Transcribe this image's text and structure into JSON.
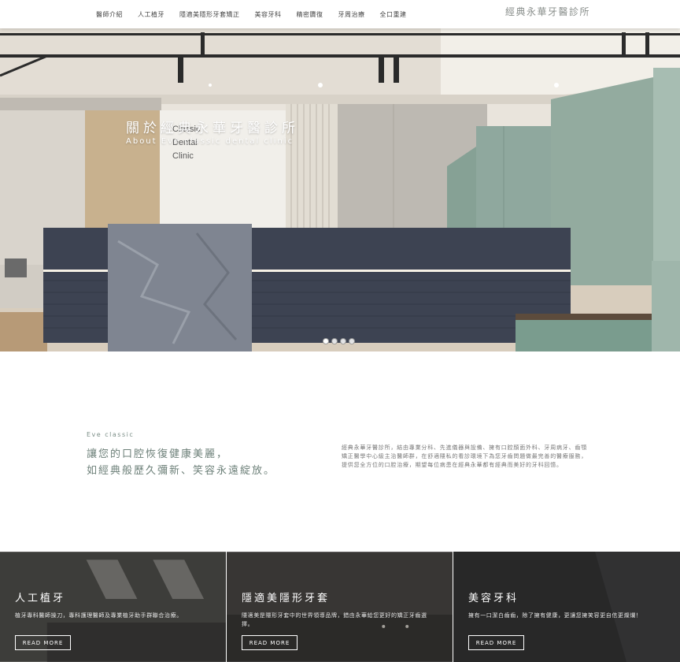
{
  "header": {
    "nav": [
      "醫師介紹",
      "人工植牙",
      "隱適美隱形牙套矯正",
      "美容牙科",
      "精密贗復",
      "牙周治療",
      "全口重建"
    ],
    "logo": "經典永華牙醫診所"
  },
  "hero": {
    "title": "關於經典永華牙醫診所",
    "subtitle": "About Eve classic dental clinic",
    "wall_sign": "Classic\nDental\nClinic",
    "slides": 4,
    "active_slide": 1
  },
  "about": {
    "eyebrow": "Eve classic",
    "headline_line1": "讓您的口腔恢復健康美麗，",
    "headline_line2": "如經典般歷久彌新、笑容永遠綻放。",
    "intro": "經典永華牙醫診所，結由專業分科、先進儀器與設備、擁有口腔顏面外科、牙周病牙、齒顎矯正醫學中心級主治醫師群，在舒適隱私的看診環境下為您牙齒問題做最完善的醫療服務，提供您全方位的口腔治療，期望每位病患在經典永華都有經典而美好的牙科回憶。"
  },
  "cards": [
    {
      "title": "人工植牙",
      "desc": "植牙專科醫師操刀，專科護理醫師及專業植牙助手群聯合治療。",
      "button": "READ MORE"
    },
    {
      "title": "隱適美隱形牙套",
      "desc": "隱適美是隱形牙套中的世界領導品牌，錯由永華給您更好的矯正牙齒選擇。",
      "button": "READ MORE"
    },
    {
      "title": "美容牙科",
      "desc": "擁有一口潔白齒齒，除了擁有健康，更讓您擁笑容更自信更燦爛！",
      "button": "READ MORE"
    }
  ],
  "colors": {
    "accent": "#6d8079",
    "mint_cabinet": "#8fa89e",
    "counter": "#3d4352"
  }
}
